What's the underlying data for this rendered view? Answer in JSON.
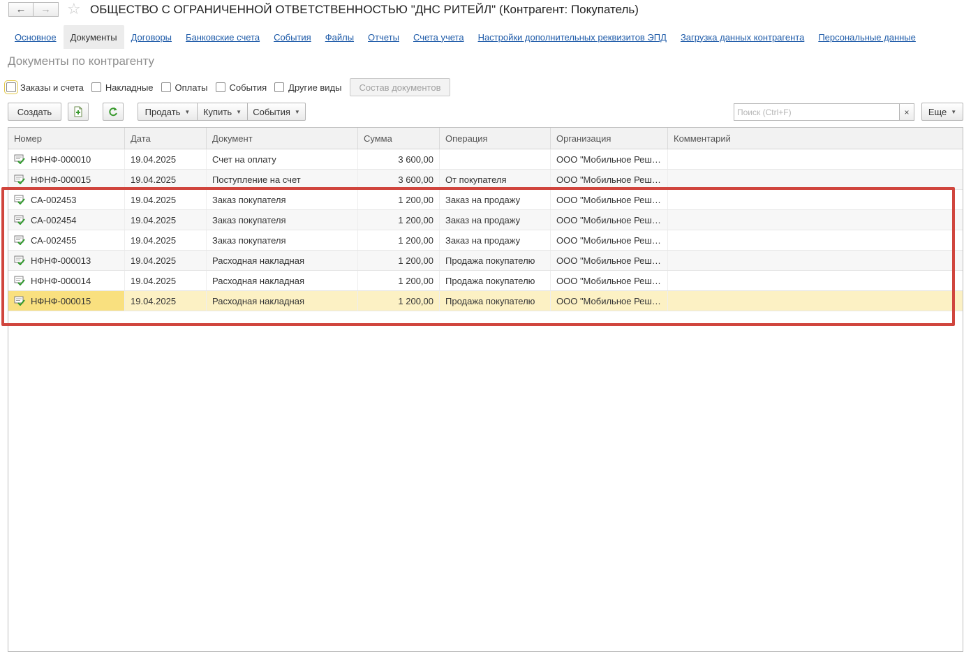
{
  "window": {
    "title": "ОБЩЕСТВО С ОГРАНИЧЕННОЙ ОТВЕТСТВЕННОСТЬЮ \"ДНС РИТЕЙЛ\" (Контрагент: Покупатель)",
    "back_icon": "←",
    "forward_icon": "→",
    "star_icon": "☆"
  },
  "tabs": [
    {
      "label": "Основное",
      "active": false
    },
    {
      "label": "Документы",
      "active": true
    },
    {
      "label": "Договоры",
      "active": false
    },
    {
      "label": "Банковские счета",
      "active": false
    },
    {
      "label": "События",
      "active": false
    },
    {
      "label": "Файлы",
      "active": false
    },
    {
      "label": "Отчеты",
      "active": false
    },
    {
      "label": "Счета учета",
      "active": false
    },
    {
      "label": "Настройки дополнительных реквизитов ЭПД",
      "active": false
    },
    {
      "label": "Загрузка данных контрагента",
      "active": false
    },
    {
      "label": "Персональные данные",
      "active": false
    }
  ],
  "section_title": "Документы по контрагенту",
  "filters": {
    "orders": "Заказы и счета",
    "invoices": "Накладные",
    "payments": "Оплаты",
    "events": "События",
    "other": "Другие виды",
    "composition_button": "Состав документов"
  },
  "toolbar": {
    "create": "Создать",
    "copy_icon": "add-document-icon",
    "refresh_icon": "refresh-icon",
    "sell": "Продать",
    "buy": "Купить",
    "events": "События",
    "search_placeholder": "Поиск (Ctrl+F)",
    "clear": "×",
    "more": "Еще",
    "caret": "▼"
  },
  "table": {
    "columns": [
      "Номер",
      "Дата",
      "Документ",
      "Сумма",
      "Операция",
      "Организация",
      "Комментарий"
    ],
    "rows": [
      {
        "number": "НФНФ-000010",
        "date": "19.04.2025",
        "document": "Счет на оплату",
        "sum": "3 600,00",
        "operation": "",
        "organization": "ООО \"Мобильное Реш…",
        "comment": ""
      },
      {
        "number": "НФНФ-000015",
        "date": "19.04.2025",
        "document": "Поступление на счет",
        "sum": "3 600,00",
        "operation": "От покупателя",
        "organization": "ООО \"Мобильное Реш…",
        "comment": ""
      },
      {
        "number": "СА-002453",
        "date": "19.04.2025",
        "document": "Заказ покупателя",
        "sum": "1 200,00",
        "operation": "Заказ на продажу",
        "organization": "ООО \"Мобильное Реш…",
        "comment": ""
      },
      {
        "number": "СА-002454",
        "date": "19.04.2025",
        "document": "Заказ покупателя",
        "sum": "1 200,00",
        "operation": "Заказ на продажу",
        "organization": "ООО \"Мобильное Реш…",
        "comment": ""
      },
      {
        "number": "СА-002455",
        "date": "19.04.2025",
        "document": "Заказ покупателя",
        "sum": "1 200,00",
        "operation": "Заказ на продажу",
        "organization": "ООО \"Мобильное Реш…",
        "comment": ""
      },
      {
        "number": "НФНФ-000013",
        "date": "19.04.2025",
        "document": "Расходная накладная",
        "sum": "1 200,00",
        "operation": "Продажа покупателю",
        "organization": "ООО \"Мобильное Реш…",
        "comment": ""
      },
      {
        "number": "НФНФ-000014",
        "date": "19.04.2025",
        "document": "Расходная накладная",
        "sum": "1 200,00",
        "operation": "Продажа покупателю",
        "organization": "ООО \"Мобильное Реш…",
        "comment": ""
      },
      {
        "number": "НФНФ-000015",
        "date": "19.04.2025",
        "document": "Расходная накладная",
        "sum": "1 200,00",
        "operation": "Продажа покупателю",
        "organization": "ООО \"Мобильное Реш…",
        "comment": ""
      }
    ],
    "selected_row": 7
  },
  "colors": {
    "link": "#1d5aa8",
    "highlight_frame": "#d0453d",
    "selected_row": "#fcf1c4",
    "selected_cell": "#f9e07f"
  }
}
